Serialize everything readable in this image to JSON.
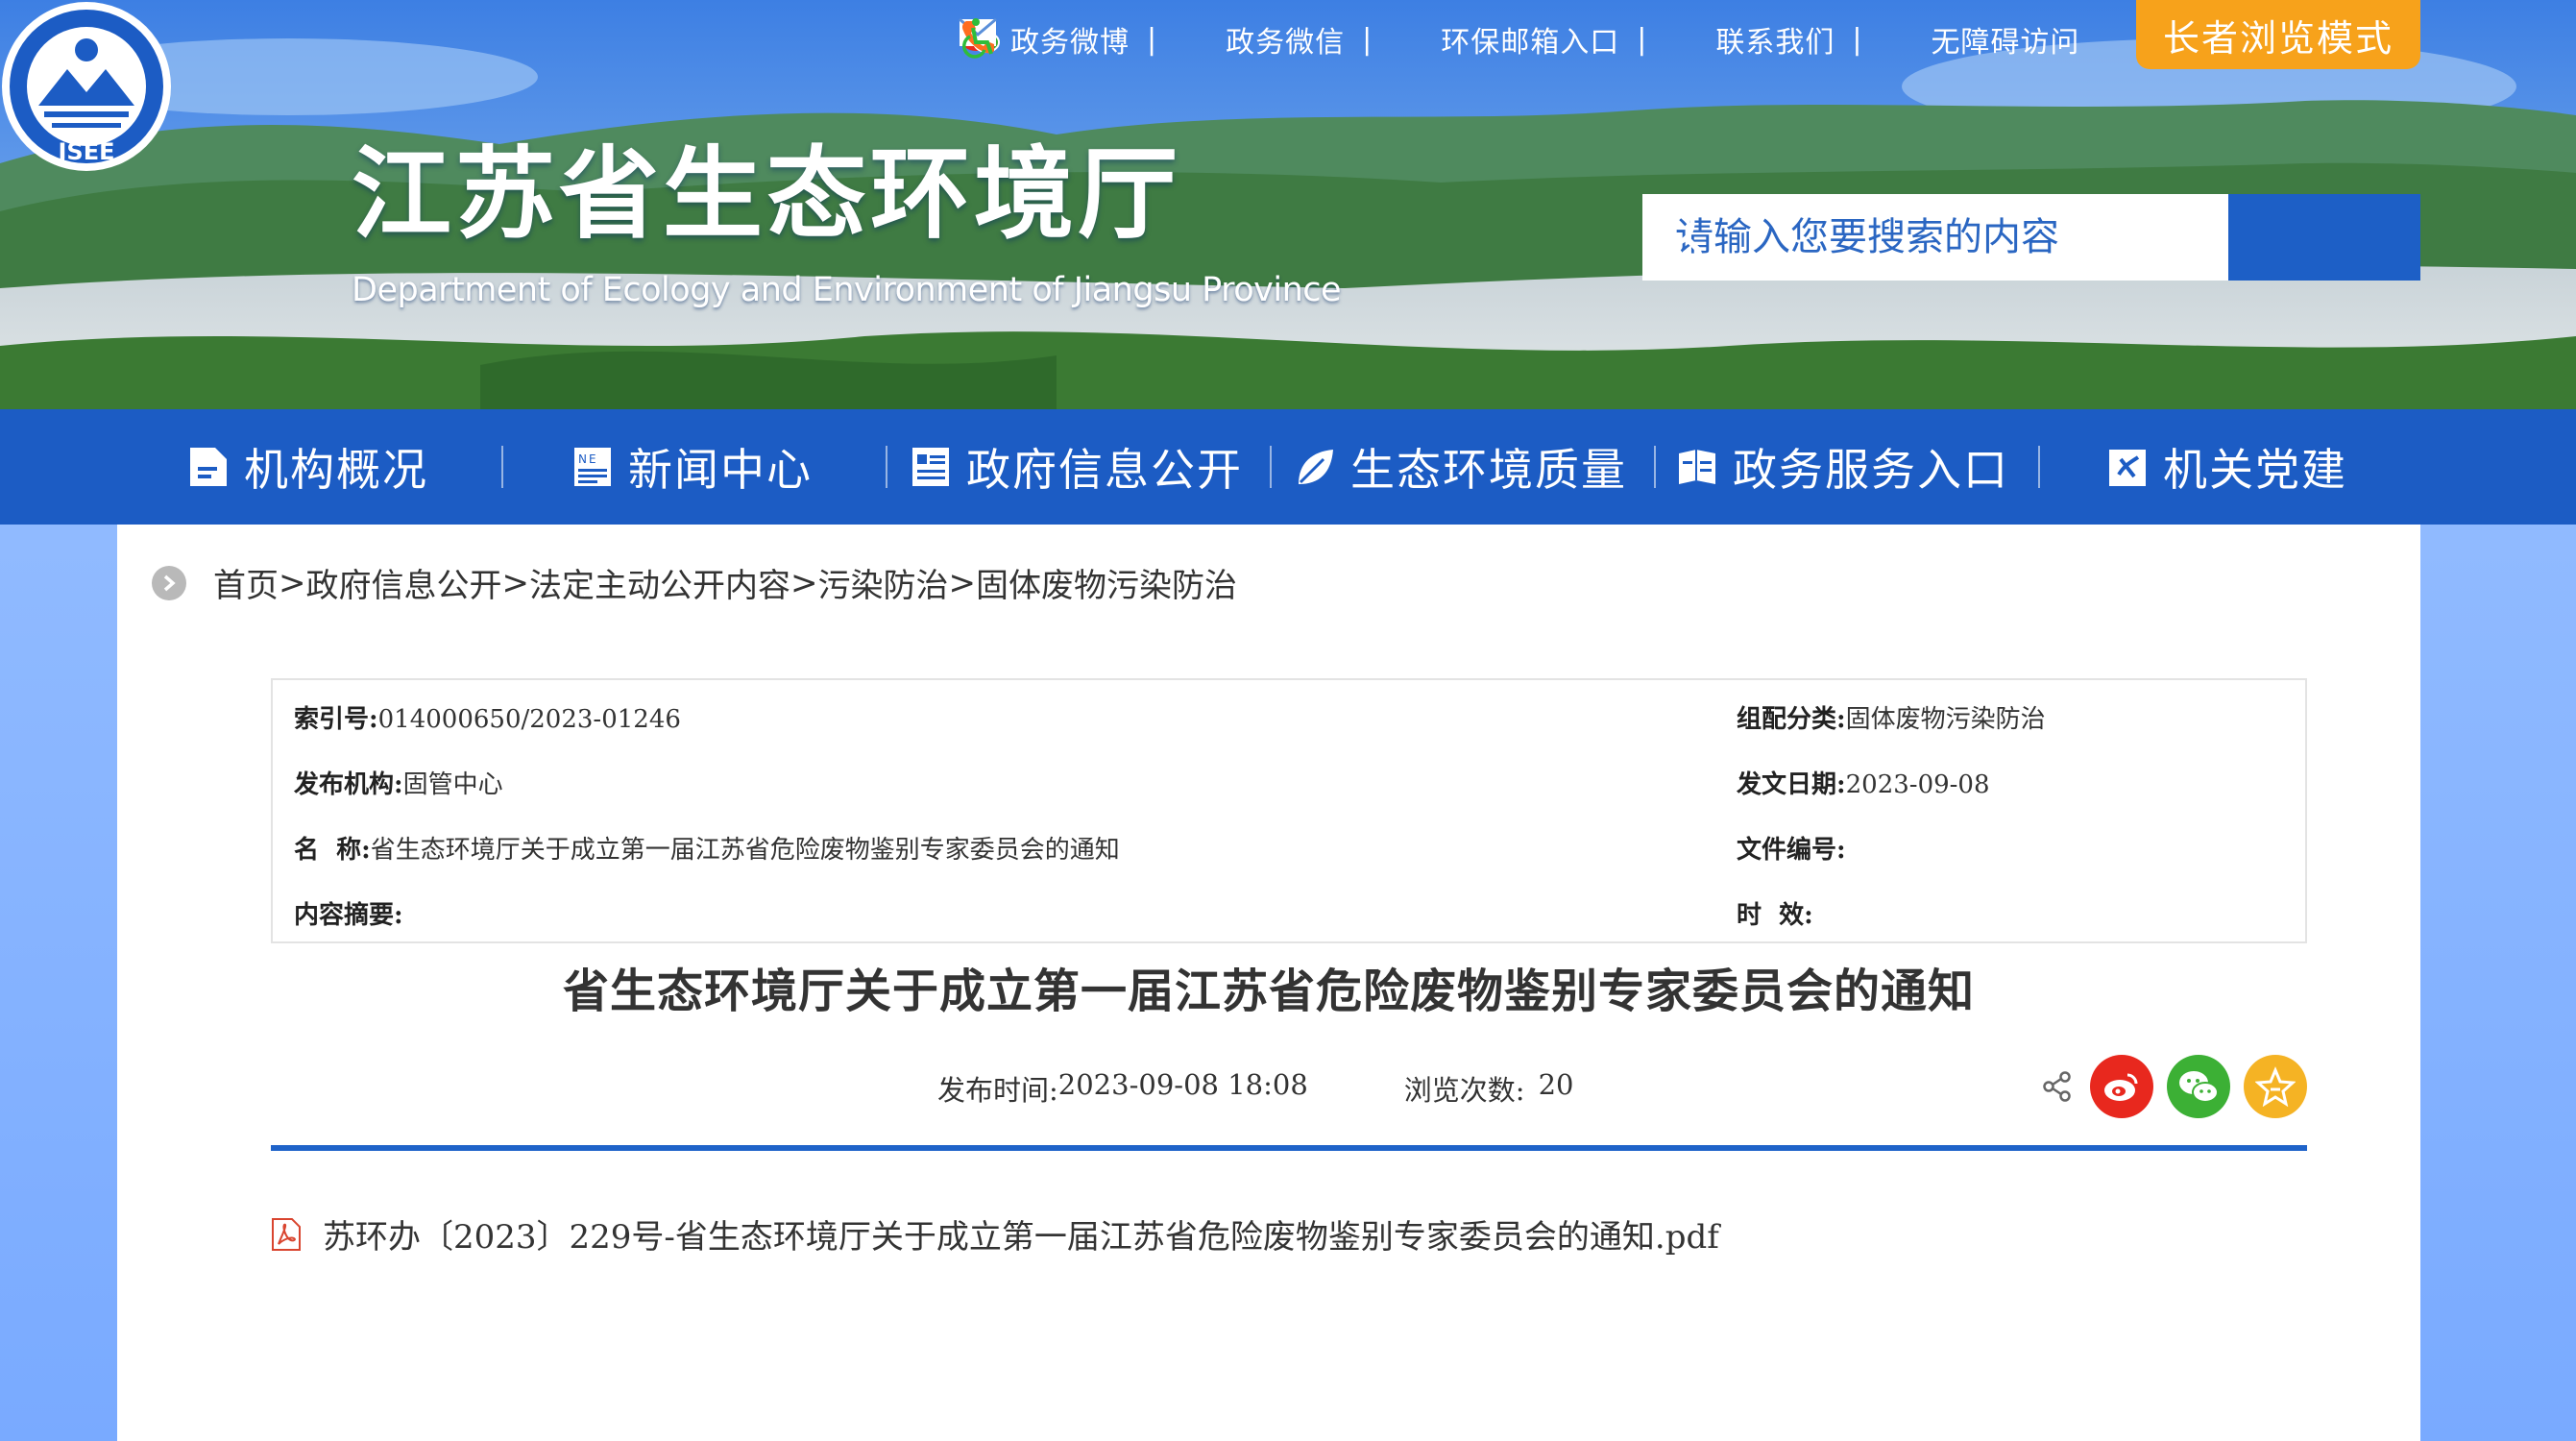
{
  "site": {
    "title": "江苏省生态环境厅",
    "subtitle": "Department of Ecology and Environment of Jiangsu Province",
    "logo_text": "JSEE"
  },
  "top_links": [
    {
      "label": "政务微博",
      "icon": "weibo-icon"
    },
    {
      "label": "政务微信",
      "icon": "wechat-icon"
    },
    {
      "label": "环保邮箱入口",
      "icon": "mail-icon"
    },
    {
      "label": "联系我们",
      "icon": "phone-icon"
    },
    {
      "label": "无障碍访问",
      "icon": "accessibility-icon"
    }
  ],
  "elder_mode": "长者浏览模式",
  "search": {
    "placeholder": "请输入您要搜索的内容"
  },
  "nav": [
    {
      "label": "机构概况",
      "icon": "document-icon"
    },
    {
      "label": "新闻中心",
      "icon": "news-icon"
    },
    {
      "label": "政府信息公开",
      "icon": "info-icon"
    },
    {
      "label": "生态环境质量",
      "icon": "leaf-icon"
    },
    {
      "label": "政务服务入口",
      "icon": "service-icon"
    },
    {
      "label": "机关党建",
      "icon": "party-icon"
    }
  ],
  "breadcrumb": [
    "首页",
    "政府信息公开",
    "法定主动公开内容",
    "污染防治",
    "固体废物污染防治"
  ],
  "breadcrumb_sep": ">",
  "meta": {
    "index_label": "索引号:",
    "index_value": "014000650/2023-01246",
    "category_label": "组配分类:",
    "category_value": "固体废物污染防治",
    "publisher_label": "发布机构:",
    "publisher_value": "固管中心",
    "date_label": "发文日期:",
    "date_value": "2023-09-08",
    "name_label": "名  称:",
    "name_value": "省生态环境厅关于成立第一届江苏省危险废物鉴别专家委员会的通知",
    "docno_label": "文件编号:",
    "docno_value": "",
    "summary_label": "内容摘要:",
    "summary_value": "",
    "validity_label": "时  效:",
    "validity_value": ""
  },
  "article": {
    "title": "省生态环境厅关于成立第一届江苏省危险废物鉴别专家委员会的通知",
    "pub_time_label": "发布时间:",
    "pub_time": "2023-09-08 18:08",
    "views_label": "浏览次数:",
    "views": "20",
    "attachment": "苏环办〔2023〕229号-省生态环境厅关于成立第一届江苏省危险废物鉴别专家委员会的通知.pdf"
  },
  "colors": {
    "nav_bg": "#1c5cc4",
    "elder_btn": "#f7a21b",
    "rule": "#1f63c9",
    "weibo": "#e8281e",
    "wechat": "#3cb035",
    "favorite": "#f5b324"
  }
}
